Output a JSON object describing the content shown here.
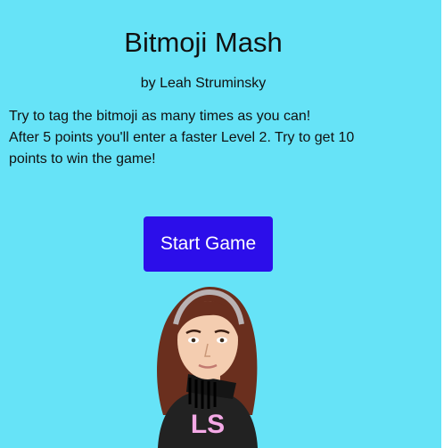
{
  "app": {
    "title": "Bitmoji Mash",
    "author": "by Leah Struminsky",
    "instructions": [
      "Try to tag the bitmoji as many times as you can!",
      "After 5 points you'll enter a faster Level 2. Try to get 10",
      "points to win the game!"
    ],
    "start_button_label": "Start Game",
    "avatar_shirt_text": "LS"
  },
  "colors": {
    "background": "#66e3f7",
    "button": "#2c0eea",
    "button_text": "#ffffff",
    "hair": "#6a2f1e",
    "shirt": "#222222",
    "shirt_letters": "#f4a9e6"
  }
}
